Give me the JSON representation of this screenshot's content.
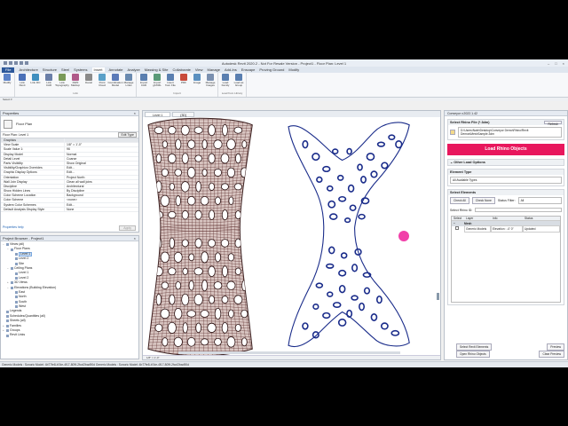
{
  "app": {
    "title": "Autodesk Revit 2020.2 - Not For Resale Version - Project1 - Floor Plan: Level 1",
    "window_controls": [
      "–",
      "□",
      "×"
    ]
  },
  "tabs": [
    "File",
    "Architecture",
    "Structure",
    "Steel",
    "Systems",
    "Insert",
    "Annotate",
    "Analyze",
    "Massing & Site",
    "Collaborate",
    "View",
    "Manage",
    "Add-Ins",
    "Enscape",
    "Proving Ground",
    "Modify"
  ],
  "active_tab": "Insert",
  "ribbon": {
    "groups": [
      {
        "name": "",
        "buttons": [
          {
            "label": "Modify",
            "icon": "modify-icon",
            "color": "#5b82c8"
          }
        ]
      },
      {
        "name": "Link",
        "buttons": [
          {
            "label": "Link Revit",
            "icon": "link-revit-icon",
            "color": "#4a70b8"
          },
          {
            "label": "Link IFC",
            "icon": "link-ifc-icon",
            "color": "#3f8fbf"
          },
          {
            "label": "Link CAD",
            "icon": "link-cad-icon",
            "color": "#6a7fa8"
          },
          {
            "label": "Link Topography",
            "icon": "link-topo-icon",
            "color": "#7a9a58"
          },
          {
            "label": "DWF Markup",
            "icon": "dwf-icon",
            "color": "#b05a8a"
          },
          {
            "label": "Decal",
            "icon": "decal-icon",
            "color": "#8a8a8a"
          },
          {
            "label": "Point Cloud",
            "icon": "point-cloud-icon",
            "color": "#5aa0c8"
          },
          {
            "label": "Coordination Model",
            "icon": "coordination-icon",
            "color": "#5a7ab8"
          },
          {
            "label": "Manage Links",
            "icon": "manage-links-icon",
            "color": "#6a8ab0"
          }
        ]
      },
      {
        "name": "Import",
        "buttons": [
          {
            "label": "Import CAD",
            "icon": "import-cad-icon",
            "color": "#5a7fb0"
          },
          {
            "label": "Import gbXML",
            "icon": "import-gbxml-icon",
            "color": "#5a9a78"
          },
          {
            "label": "Insert from File",
            "icon": "insert-file-icon",
            "color": "#5a7fb0"
          },
          {
            "label": "PDF",
            "icon": "pdf-icon",
            "color": "#c84a3a"
          },
          {
            "label": "Image",
            "icon": "image-icon",
            "color": "#5a90c0"
          },
          {
            "label": "Manage Images",
            "icon": "manage-images-icon",
            "color": "#7a90b0"
          }
        ]
      },
      {
        "name": "Load from Library",
        "buttons": [
          {
            "label": "Load Family",
            "icon": "load-family-icon",
            "color": "#5a7fb0"
          },
          {
            "label": "Load as Group",
            "icon": "load-group-icon",
            "color": "#5a7fb0"
          }
        ]
      }
    ],
    "select_label": "Select ▾"
  },
  "properties": {
    "title": "Properties",
    "type_name": "Floor Plan",
    "instance_label": "Floor Plan: Level 1",
    "edit_type": "Edit Type",
    "rows": [
      {
        "k": "Graphics",
        "v": "",
        "cat": true
      },
      {
        "k": "View Scale",
        "v": "1/8\" = 1'-0\""
      },
      {
        "k": "Scale Value    1:",
        "v": "96"
      },
      {
        "k": "Display Model",
        "v": "Normal"
      },
      {
        "k": "Detail Level",
        "v": "Coarse"
      },
      {
        "k": "Parts Visibility",
        "v": "Show Original"
      },
      {
        "k": "Visibility/Graphics Overrides",
        "v": "Edit..."
      },
      {
        "k": "Graphic Display Options",
        "v": "Edit..."
      },
      {
        "k": "Orientation",
        "v": "Project North"
      },
      {
        "k": "Wall Join Display",
        "v": "Clean all wall joins"
      },
      {
        "k": "Discipline",
        "v": "Architectural"
      },
      {
        "k": "Show Hidden Lines",
        "v": "By Discipline"
      },
      {
        "k": "Color Scheme Location",
        "v": "Background"
      },
      {
        "k": "Color Scheme",
        "v": "<none>"
      },
      {
        "k": "System Color Schemes",
        "v": "Edit..."
      },
      {
        "k": "Default Analysis Display Style",
        "v": "None"
      }
    ],
    "help_link": "Properties help",
    "apply": "Apply"
  },
  "browser": {
    "title": "Project Browser - Project1",
    "nodes": [
      {
        "t": "Views (all)",
        "d": 0,
        "tg": "−"
      },
      {
        "t": "Floor Plans",
        "d": 1,
        "tg": "−"
      },
      {
        "t": "Level 1",
        "d": 2,
        "tg": "",
        "sel": true
      },
      {
        "t": "Level 2",
        "d": 2,
        "tg": ""
      },
      {
        "t": "Site",
        "d": 2,
        "tg": ""
      },
      {
        "t": "Ceiling Plans",
        "d": 1,
        "tg": "−"
      },
      {
        "t": "Level 1",
        "d": 2,
        "tg": ""
      },
      {
        "t": "Level 2",
        "d": 2,
        "tg": ""
      },
      {
        "t": "3D Views",
        "d": 1,
        "tg": "+"
      },
      {
        "t": "Elevations (Building Elevation)",
        "d": 1,
        "tg": "−"
      },
      {
        "t": "East",
        "d": 2,
        "tg": ""
      },
      {
        "t": "North",
        "d": 2,
        "tg": ""
      },
      {
        "t": "South",
        "d": 2,
        "tg": ""
      },
      {
        "t": "West",
        "d": 2,
        "tg": ""
      },
      {
        "t": "Legends",
        "d": 0,
        "tg": ""
      },
      {
        "t": "Schedules/Quantities (all)",
        "d": 0,
        "tg": ""
      },
      {
        "t": "Sheets (all)",
        "d": 0,
        "tg": ""
      },
      {
        "t": "Families",
        "d": 0,
        "tg": "+"
      },
      {
        "t": "Groups",
        "d": 0,
        "tg": "+"
      },
      {
        "t": "Revit Links",
        "d": 0,
        "tg": ""
      }
    ]
  },
  "view": {
    "tabs": [
      "Level 1",
      "{3D}"
    ],
    "scale_label": "1/8\" = 1'-0\""
  },
  "grasshopper": {
    "title": "Conveyor v.2022.1.42",
    "select_file_header": "Select Rhino File (*.3dm)",
    "refresh": "Refresh",
    "file_path": "D:\\Users\\Nate\\Desktop\\Conveyor Demo\\Rhino\\Revit Demos\\MeshSample.3dm",
    "load_button": "Load Rhino Objects",
    "other_options": "Other Load Options",
    "element_type_header": "Element Type",
    "element_type_value": "All Available Types",
    "select_elements_header": "Select Elements",
    "check_all": "Check All",
    "check_none": "Check None",
    "status_filter_label": "Status Filter:",
    "status_filter_value": "All",
    "select_rhino_id": "Select Rhino ID:",
    "table_headers": [
      "Select",
      "Layer",
      "Info",
      "Status"
    ],
    "table_rows": [
      {
        "layer": "Mesh",
        "info": "",
        "status": "",
        "group": true
      },
      {
        "layer": "Generic Models",
        "info": "Elevation : -0' 0\"",
        "status": "Updated"
      }
    ],
    "select_revit": "Select Revit Elements",
    "preview": "Preview",
    "open_rhino": "Open Rhino Objects",
    "clear_preview": "Clear Preview"
  },
  "statusbar": "Generic Models : Sonoric Model: 4b77fe8-b7de-4f17-809f-2fccf2bad90d   Generic Models : Sonoric Model: 4b77fe8-b7de-4f17-809f-2fccf2bad90d"
}
